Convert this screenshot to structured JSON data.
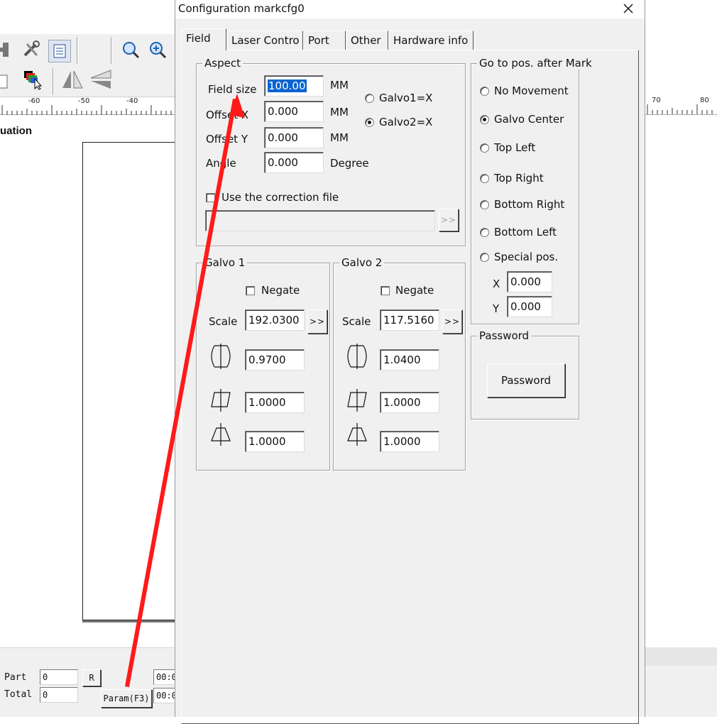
{
  "background": {
    "ruler_left": [
      "-60",
      "-50",
      "-40"
    ],
    "ruler_right": [
      "70",
      "80"
    ],
    "panel_title": "uation",
    "status": {
      "part_label": "Part",
      "part_value": "0",
      "total_label": "Total",
      "total_value": "0",
      "r_button": "R",
      "param_button": "Param(F3)",
      "time_1": "00:0",
      "time_2": "00:0"
    }
  },
  "dialog": {
    "title": "Configuration markcfg0",
    "tabs": [
      "Field",
      "Laser Contro",
      "Port",
      "Other",
      "Hardware info"
    ],
    "aspect": {
      "label": "Aspect",
      "field_size_label": "Field size",
      "field_size_value": "100.00",
      "offset_x_label": "Offset X",
      "offset_x_value": "0.000",
      "offset_y_label": "Offset Y",
      "offset_y_value": "0.000",
      "angle_label": "Angle",
      "angle_value": "0.000",
      "unit_mm": "MM",
      "unit_degree": "Degree",
      "galvo1_x": "Galvo1=X",
      "galvo2_x": "Galvo2=X",
      "use_correction": "Use the correction file",
      "correction_path": "",
      "browse": ">>"
    },
    "galvo1": {
      "label": "Galvo 1",
      "negate": "Negate",
      "scale_label": "Scale",
      "scale_value": "192.0300",
      "scale_btn": ">>",
      "barrel_value": "0.9700",
      "parallel_value": "1.0000",
      "trapezoid_value": "1.0000"
    },
    "galvo2": {
      "label": "Galvo 2",
      "negate": "Negate",
      "scale_label": "Scale",
      "scale_value": "117.5160",
      "scale_btn": ">>",
      "barrel_value": "1.0400",
      "parallel_value": "1.0000",
      "trapezoid_value": "1.0000"
    },
    "goto": {
      "label": "Go to pos. after Mark",
      "options": [
        "No Movement",
        "Galvo Center",
        "Top Left",
        "Top Right",
        "Bottom Right",
        "Bottom Left",
        "Special pos."
      ],
      "selected": "Galvo Center",
      "x_label": "X",
      "x_value": "0.000",
      "y_label": "Y",
      "y_value": "0.000"
    },
    "password": {
      "label": "Password",
      "button": "Password"
    }
  },
  "colors": {
    "annotation_arrow": "#ff1a1a",
    "selection": "#0a64d0",
    "dialog_bg": "#f0f0f0"
  },
  "icons": [
    "close-icon",
    "barrel-distortion-icon",
    "parallelogram-distortion-icon",
    "trapezoid-distortion-icon",
    "zoom-icon",
    "zoom-in-icon",
    "tools-icon",
    "list-icon",
    "layers-icon",
    "mirror-horizontal-icon",
    "mirror-vertical-icon"
  ]
}
